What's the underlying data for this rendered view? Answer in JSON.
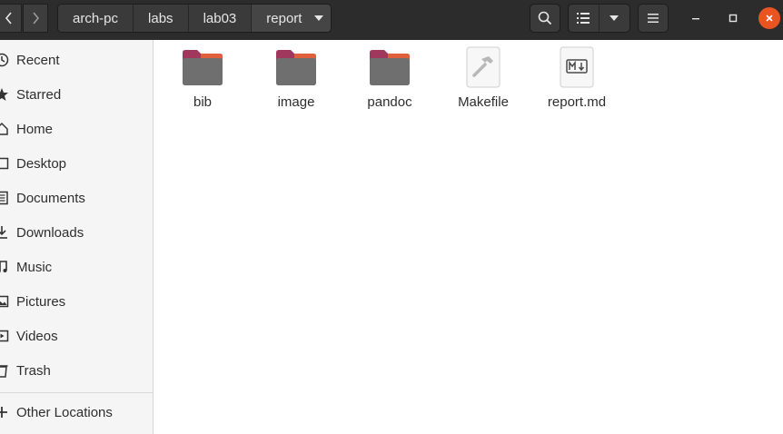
{
  "header": {
    "breadcrumbs": [
      "arch-pc",
      "labs",
      "lab03",
      "report"
    ],
    "icons": {
      "back": "chevron-left-icon",
      "forward": "chevron-right-icon",
      "search": "search-icon",
      "list_view": "list-view-icon",
      "view_options": "chevron-down-icon",
      "menu": "hamburger-menu-icon",
      "minimize": "minimize-icon",
      "maximize": "maximize-icon",
      "close": "close-icon"
    },
    "colors": {
      "bar": "#2c2c2c",
      "close": "#e95420"
    }
  },
  "sidebar": {
    "items": [
      {
        "label": "Recent",
        "icon": "clock-icon"
      },
      {
        "label": "Starred",
        "icon": "star-icon"
      },
      {
        "label": "Home",
        "icon": "home-icon"
      },
      {
        "label": "Desktop",
        "icon": "desktop-icon"
      },
      {
        "label": "Documents",
        "icon": "documents-icon"
      },
      {
        "label": "Downloads",
        "icon": "download-icon"
      },
      {
        "label": "Music",
        "icon": "music-icon"
      },
      {
        "label": "Pictures",
        "icon": "pictures-icon"
      },
      {
        "label": "Videos",
        "icon": "videos-icon"
      },
      {
        "label": "Trash",
        "icon": "trash-icon"
      }
    ],
    "other_locations": {
      "label": "Other Locations",
      "icon": "plus-icon"
    }
  },
  "files": [
    {
      "name": "bib",
      "type": "folder"
    },
    {
      "name": "image",
      "type": "folder"
    },
    {
      "name": "pandoc",
      "type": "folder"
    },
    {
      "name": "Makefile",
      "type": "makefile"
    },
    {
      "name": "report.md",
      "type": "markdown"
    }
  ]
}
